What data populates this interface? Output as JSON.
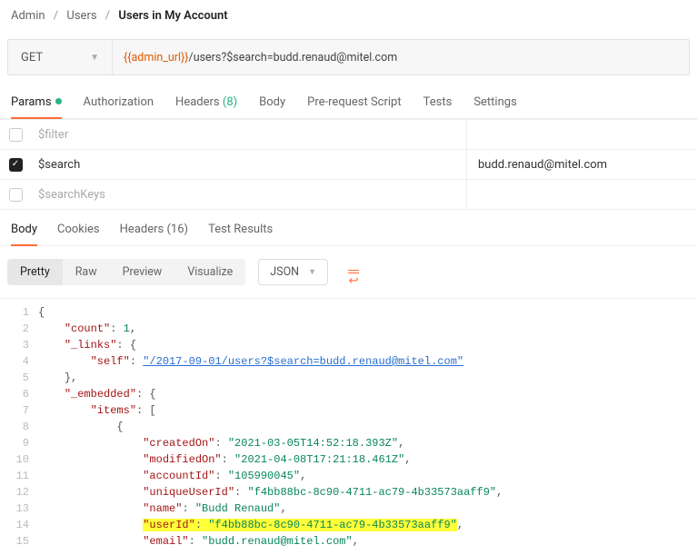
{
  "breadcrumb": {
    "a": "Admin",
    "b": "Users",
    "c": "Users in My Account"
  },
  "request": {
    "method": "GET",
    "url_var": "{{admin_url}}",
    "url_rest": "/users?$search=budd.renaud@mitel.com"
  },
  "req_tabs": {
    "params": "Params",
    "auth": "Authorization",
    "headers_label": "Headers",
    "headers_count": "(8)",
    "body": "Body",
    "prereq": "Pre-request Script",
    "tests": "Tests",
    "settings": "Settings"
  },
  "params": [
    {
      "checked": false,
      "key": "$filter",
      "value": ""
    },
    {
      "checked": true,
      "key": "$search",
      "value": "budd.renaud@mitel.com"
    },
    {
      "checked": false,
      "key": "$searchKeys",
      "value": ""
    }
  ],
  "resp_tabs": {
    "body": "Body",
    "cookies": "Cookies",
    "headers_label": "Headers",
    "headers_count": "(16)",
    "tests": "Test Results"
  },
  "view_modes": {
    "pretty": "Pretty",
    "raw": "Raw",
    "preview": "Preview",
    "visualize": "Visualize",
    "lang": "JSON"
  },
  "body_lines": [
    {
      "n": 1,
      "indent": 0,
      "raw": "{"
    },
    {
      "n": 2,
      "indent": 1,
      "key": "count",
      "num": 1,
      "comma": true
    },
    {
      "n": 3,
      "indent": 1,
      "key": "_links",
      "open": "{"
    },
    {
      "n": 4,
      "indent": 2,
      "key": "self",
      "link": "/2017-09-01/users?$search=budd.renaud@mitel.com"
    },
    {
      "n": 5,
      "indent": 1,
      "raw": "},"
    },
    {
      "n": 6,
      "indent": 1,
      "key": "_embedded",
      "open": "{"
    },
    {
      "n": 7,
      "indent": 2,
      "key": "items",
      "open": "["
    },
    {
      "n": 8,
      "indent": 3,
      "raw": "{"
    },
    {
      "n": 9,
      "indent": 4,
      "key": "createdOn",
      "str": "2021-03-05T14:52:18.393Z",
      "comma": true
    },
    {
      "n": 10,
      "indent": 4,
      "key": "modifiedOn",
      "str": "2021-04-08T17:21:18.461Z",
      "comma": true
    },
    {
      "n": 11,
      "indent": 4,
      "key": "accountId",
      "str": "105990045",
      "comma": true
    },
    {
      "n": 12,
      "indent": 4,
      "key": "uniqueUserId",
      "str": "f4bb88bc-8c90-4711-ac79-4b33573aaff9",
      "comma": true
    },
    {
      "n": 13,
      "indent": 4,
      "key": "name",
      "str": "Budd Renaud",
      "comma": true
    },
    {
      "n": 14,
      "indent": 4,
      "key": "userId",
      "str": "f4bb88bc-8c90-4711-ac79-4b33573aaff9",
      "comma": true,
      "highlight": true
    },
    {
      "n": 15,
      "indent": 4,
      "key": "email",
      "str": "budd.renaud@mitel.com",
      "comma": true
    }
  ]
}
